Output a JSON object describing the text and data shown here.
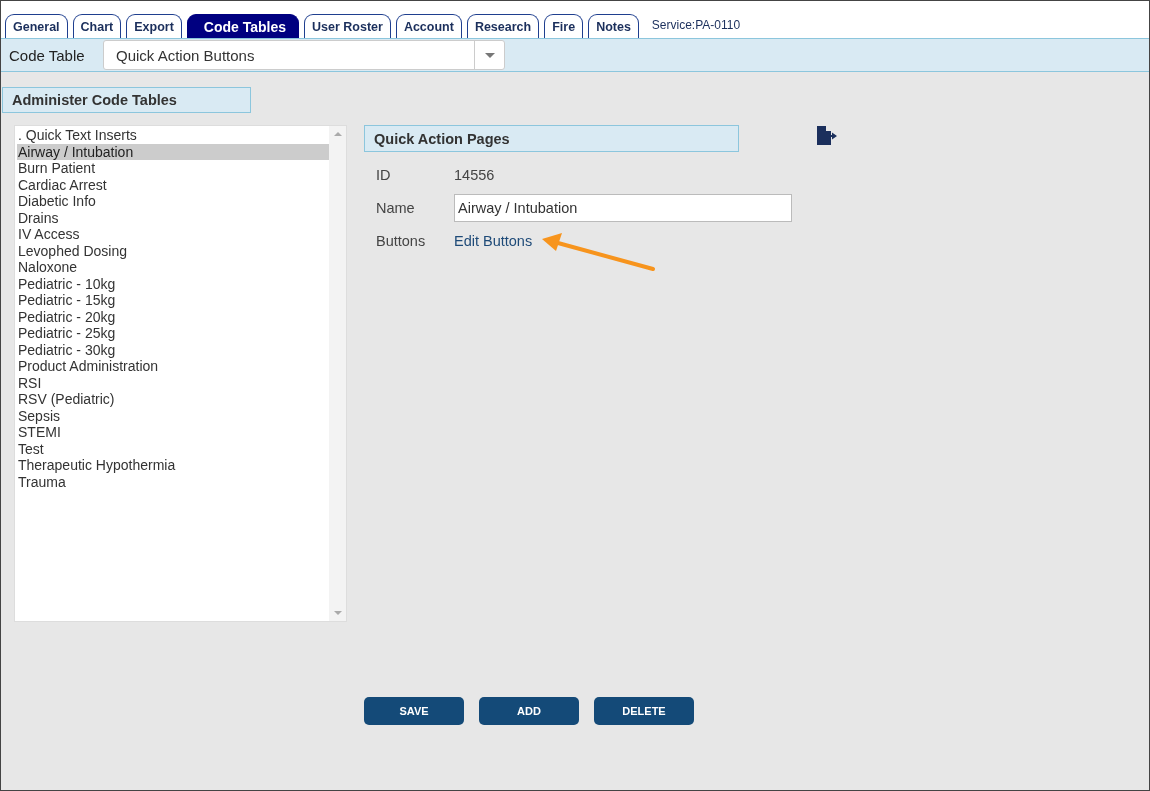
{
  "tabs": [
    {
      "label": "General",
      "selected": false
    },
    {
      "label": "Chart",
      "selected": false
    },
    {
      "label": "Export",
      "selected": false
    },
    {
      "label": "Code Tables",
      "selected": true
    },
    {
      "label": "User Roster",
      "selected": false
    },
    {
      "label": "Account",
      "selected": false
    },
    {
      "label": "Research",
      "selected": false
    },
    {
      "label": "Fire",
      "selected": false
    },
    {
      "label": "Notes",
      "selected": false
    }
  ],
  "service": "Service:PA-0110",
  "code_table": {
    "label": "Code Table",
    "value": "Quick Action Buttons"
  },
  "section_title": "Administer Code Tables",
  "list_items": [
    {
      "label": ". Quick Text Inserts",
      "selected": false
    },
    {
      "label": "Airway / Intubation",
      "selected": true
    },
    {
      "label": "Burn Patient",
      "selected": false
    },
    {
      "label": "Cardiac Arrest",
      "selected": false
    },
    {
      "label": "Diabetic Info",
      "selected": false
    },
    {
      "label": "Drains",
      "selected": false
    },
    {
      "label": "IV Access",
      "selected": false
    },
    {
      "label": "Levophed Dosing",
      "selected": false
    },
    {
      "label": "Naloxone",
      "selected": false
    },
    {
      "label": "Pediatric - 10kg",
      "selected": false
    },
    {
      "label": "Pediatric - 15kg",
      "selected": false
    },
    {
      "label": "Pediatric - 20kg",
      "selected": false
    },
    {
      "label": "Pediatric - 25kg",
      "selected": false
    },
    {
      "label": "Pediatric - 30kg",
      "selected": false
    },
    {
      "label": "Product Administration",
      "selected": false
    },
    {
      "label": "RSI",
      "selected": false
    },
    {
      "label": "RSV (Pediatric)",
      "selected": false
    },
    {
      "label": "Sepsis",
      "selected": false
    },
    {
      "label": "STEMI",
      "selected": false
    },
    {
      "label": "Test",
      "selected": false
    },
    {
      "label": "Therapeutic Hypothermia",
      "selected": false
    },
    {
      "label": "Trauma",
      "selected": false
    }
  ],
  "detail": {
    "title": "Quick Action Pages",
    "fields": [
      {
        "kind": "text",
        "label": "ID",
        "value": "14556"
      },
      {
        "kind": "input",
        "label": "Name",
        "value": "Airway / Intubation"
      },
      {
        "kind": "link",
        "label": "Buttons",
        "value": "Edit Buttons"
      }
    ]
  },
  "buttons": [
    "SAVE",
    "ADD",
    "DELETE"
  ]
}
